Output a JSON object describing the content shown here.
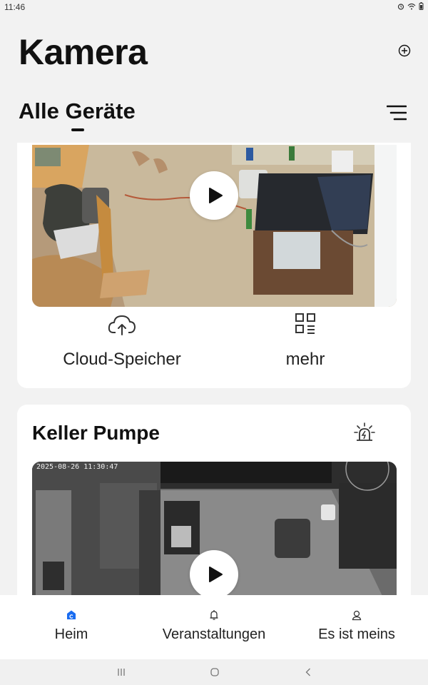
{
  "status_bar": {
    "time": "11:46",
    "icons": [
      "alarm-icon",
      "wifi-icon",
      "battery-icon"
    ]
  },
  "header": {
    "title": "Kamera",
    "add_icon": "plus-circle-icon"
  },
  "section": {
    "title": "Alle Geräte",
    "filter_icon": "filter-lines-icon"
  },
  "cards": [
    {
      "actions": [
        {
          "label": "Cloud-Speicher",
          "icon": "cloud-upload-icon"
        },
        {
          "label": "mehr",
          "icon": "grid-menu-icon"
        }
      ]
    },
    {
      "device_name": "Keller Pumpe",
      "alarm_icon": "siren-icon",
      "timestamp": "2025-08-26 11:30:47"
    }
  ],
  "bottom_nav": [
    {
      "label": "Heim",
      "icon": "home-icon",
      "active": true
    },
    {
      "label": "Veranstaltungen",
      "icon": "bell-icon",
      "active": false
    },
    {
      "label": "Es ist meins",
      "icon": "profile-icon",
      "active": false
    }
  ],
  "colors": {
    "accent": "#1a6cf0",
    "card": "#ffffff",
    "background": "#f2f2f2"
  }
}
